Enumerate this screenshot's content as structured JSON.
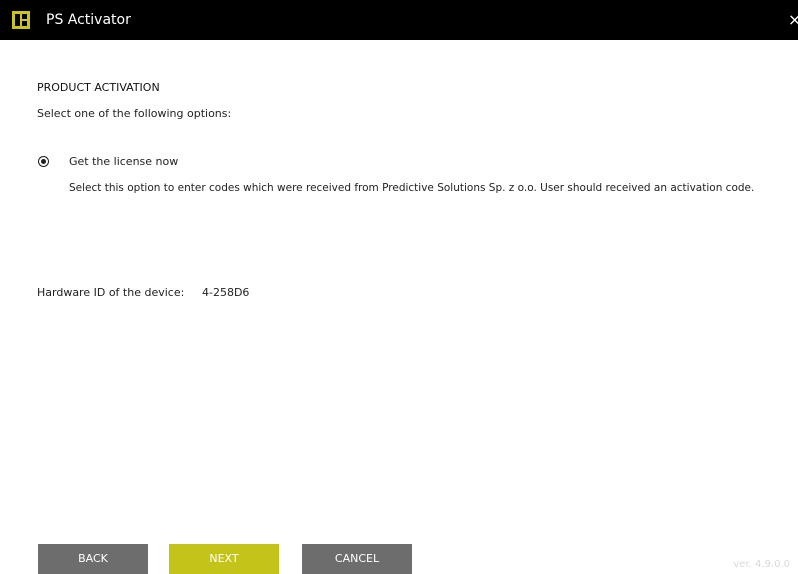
{
  "window": {
    "title": "PS Activator",
    "close_glyph": "×"
  },
  "main": {
    "heading": "PRODUCT ACTIVATION",
    "subtitle": "Select one of the following options:",
    "option": {
      "label": "Get the license now",
      "selected": true,
      "description": "Select this option to enter codes which were received from Predictive Solutions Sp. z o.o. User should received an activation code."
    },
    "hardware": {
      "label": "Hardware ID of the device:",
      "value": "4-258D6"
    }
  },
  "footer": {
    "back_label": "BACK",
    "next_label": "NEXT",
    "cancel_label": "CANCEL",
    "version": "ver. 4.9.0.0"
  },
  "colors": {
    "titlebar": "#000000",
    "accent": "#c4c31a",
    "button_gray": "#6d6d6d"
  },
  "icons": {
    "app": "app-logo-icon",
    "close": "close-icon",
    "radio": "radio-selected-icon"
  }
}
